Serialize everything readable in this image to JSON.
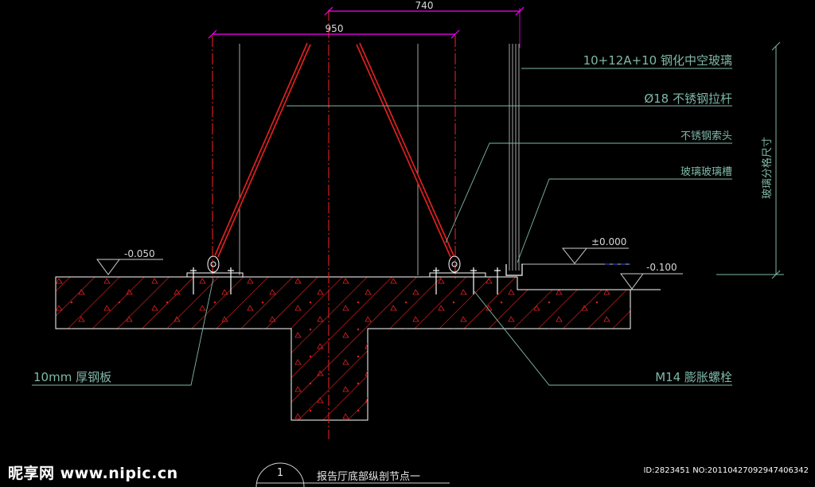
{
  "dimensions": {
    "top": "740",
    "second": "950"
  },
  "labels": {
    "glass": "10+12A+10 钢化中空玻璃",
    "rod": "Ø18 不锈钢拉杆",
    "cable_head": "不锈钢索头",
    "glass_slot": "玻璃玻璃槽",
    "plate": "10mm 厚钢板",
    "bolt": "M14 膨胀螺栓",
    "vertical": "玻璃分格尺寸"
  },
  "levels": {
    "left": "-0.050",
    "zero": "±0.000",
    "right": "-0.100"
  },
  "title": {
    "number": "1",
    "text": "报告厅底部纵剖节点一"
  },
  "watermark": {
    "left": "昵享网 www.nipic.cn",
    "right": "ID:2823451 NO:20110427092947406342"
  },
  "colors": {
    "background": "#000000",
    "hatch": "#e02020",
    "dimension": "#ff00ff",
    "leader": "#7fb8a8",
    "centerline": "#e02020"
  }
}
